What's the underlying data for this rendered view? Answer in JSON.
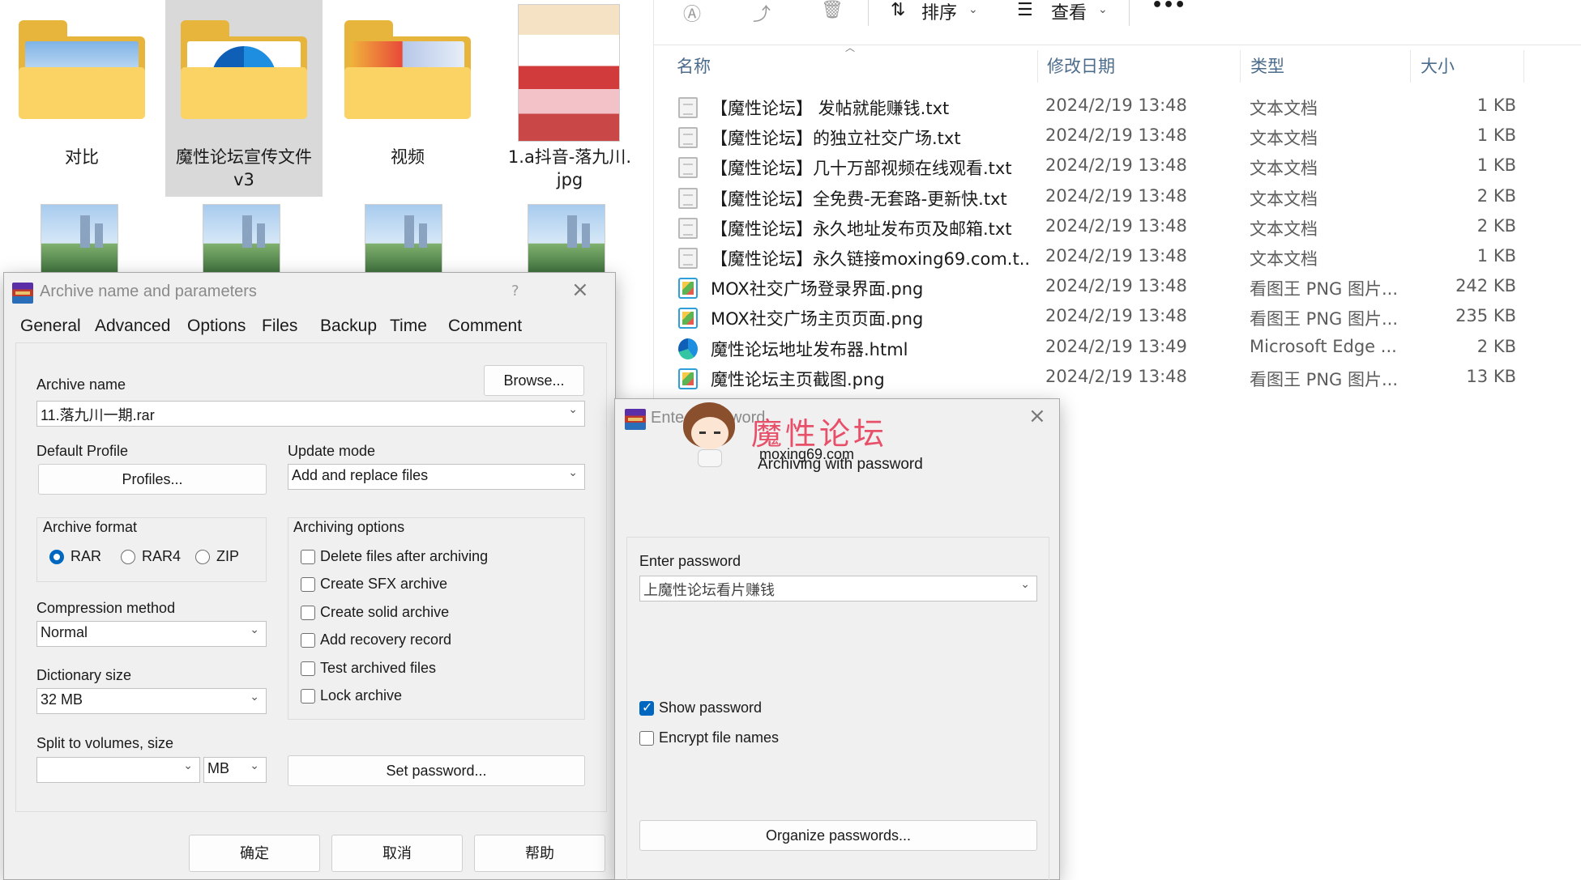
{
  "left_pane": {
    "folders": [
      {
        "label": "对比"
      },
      {
        "label": "魔性论坛宣传文件v3",
        "line1": "魔性论坛宣传文件",
        "line2": "v3"
      },
      {
        "label": "视频"
      },
      {
        "label": "1.a抖音-落九川.jpg",
        "line1": "1.a抖音-落九川.",
        "line2": "jpg"
      }
    ]
  },
  "explorer": {
    "toolbar": {
      "sort": "排序",
      "view": "查看",
      "more": "•••"
    },
    "columns": {
      "name": "名称",
      "date": "修改日期",
      "type": "类型",
      "size": "大小"
    },
    "files": [
      {
        "name": "【魔性论坛】 发帖就能赚钱.txt",
        "date": "2024/2/19 13:48",
        "type": "文本文档",
        "size": "1 KB",
        "icon": "text-file-icon"
      },
      {
        "name": "【魔性论坛】的独立社交广场.txt",
        "date": "2024/2/19 13:48",
        "type": "文本文档",
        "size": "1 KB",
        "icon": "text-file-icon"
      },
      {
        "name": "【魔性论坛】几十万部视频在线观看.txt",
        "date": "2024/2/19 13:48",
        "type": "文本文档",
        "size": "1 KB",
        "icon": "text-file-icon"
      },
      {
        "name": "【魔性论坛】全免费-无套路-更新快.txt",
        "date": "2024/2/19 13:48",
        "type": "文本文档",
        "size": "2 KB",
        "icon": "text-file-icon"
      },
      {
        "name": "【魔性论坛】永久地址发布页及邮箱.txt",
        "date": "2024/2/19 13:48",
        "type": "文本文档",
        "size": "2 KB",
        "icon": "text-file-icon"
      },
      {
        "name": "【魔性论坛】永久链接moxing69.com.t...",
        "date": "2024/2/19 13:48",
        "type": "文本文档",
        "size": "1 KB",
        "icon": "text-file-icon"
      },
      {
        "name": "MOX社交广场登录界面.png",
        "date": "2024/2/19 13:48",
        "type": "看图王 PNG 图片...",
        "size": "242 KB",
        "icon": "image-file-icon"
      },
      {
        "name": "MOX社交广场主页页面.png",
        "date": "2024/2/19 13:48",
        "type": "看图王 PNG 图片...",
        "size": "235 KB",
        "icon": "image-file-icon"
      },
      {
        "name": "魔性论坛地址发布器.html",
        "date": "2024/2/19 13:49",
        "type": "Microsoft Edge ...",
        "size": "2 KB",
        "icon": "edge-icon"
      },
      {
        "name": "魔性论坛主页截图.png",
        "date": "2024/2/19 13:48",
        "type": "看图王 PNG 图片...",
        "size": "13 KB",
        "icon": "image-file-icon"
      }
    ]
  },
  "archive_dialog": {
    "title": "Archive name and parameters",
    "help": "?",
    "tabs": [
      "General",
      "Advanced",
      "Options",
      "Files",
      "Backup",
      "Time",
      "Comment"
    ],
    "archive_name_label": "Archive name",
    "browse_button": "Browse...",
    "archive_name_value": "11.落九川一期.rar",
    "default_profile_label": "Default Profile",
    "profiles_button": "Profiles...",
    "update_mode_label": "Update mode",
    "update_mode_value": "Add and replace files",
    "archive_format_label": "Archive format",
    "formats": [
      {
        "label": "RAR",
        "selected": true
      },
      {
        "label": "RAR4",
        "selected": false
      },
      {
        "label": "ZIP",
        "selected": false
      }
    ],
    "archiving_options_label": "Archiving options",
    "options": [
      {
        "label": "Delete files after archiving",
        "checked": false
      },
      {
        "label": "Create SFX archive",
        "checked": false
      },
      {
        "label": "Create solid archive",
        "checked": false
      },
      {
        "label": "Add recovery record",
        "checked": false
      },
      {
        "label": "Test archived files",
        "checked": false
      },
      {
        "label": "Lock archive",
        "checked": false
      }
    ],
    "compression_method_label": "Compression method",
    "compression_method_value": "Normal",
    "dictionary_size_label": "Dictionary size",
    "dictionary_size_value": "32 MB",
    "split_label": "Split to volumes, size",
    "split_value": "",
    "split_unit": "MB",
    "set_password_button": "Set password...",
    "ok_button": "确定",
    "cancel_button": "取消",
    "help_button": "帮助"
  },
  "password_dialog": {
    "title_visible": "Ente",
    "title_visible_tail": "word",
    "watermark_brand": "魔性论坛",
    "watermark_url": "moxing69.com",
    "subtitle": "Archiving with password",
    "enter_password_label": "Enter password",
    "password_value": "上魔性论坛看片赚钱",
    "show_password_label": "Show password",
    "show_password_checked": true,
    "encrypt_names_label": "Encrypt file names",
    "encrypt_names_checked": false,
    "organize_button": "Organize passwords..."
  }
}
